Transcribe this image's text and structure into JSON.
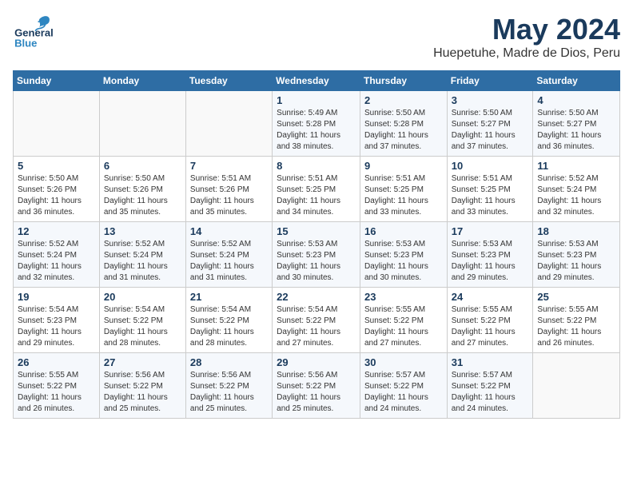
{
  "header": {
    "logo": {
      "general": "General",
      "blue": "Blue"
    },
    "title": "May 2024",
    "subtitle": "Huepetuhe, Madre de Dios, Peru"
  },
  "weekdays": [
    "Sunday",
    "Monday",
    "Tuesday",
    "Wednesday",
    "Thursday",
    "Friday",
    "Saturday"
  ],
  "weeks": [
    [
      {
        "day": "",
        "info": ""
      },
      {
        "day": "",
        "info": ""
      },
      {
        "day": "",
        "info": ""
      },
      {
        "day": "1",
        "info": "Sunrise: 5:49 AM\nSunset: 5:28 PM\nDaylight: 11 hours\nand 38 minutes."
      },
      {
        "day": "2",
        "info": "Sunrise: 5:50 AM\nSunset: 5:28 PM\nDaylight: 11 hours\nand 37 minutes."
      },
      {
        "day": "3",
        "info": "Sunrise: 5:50 AM\nSunset: 5:27 PM\nDaylight: 11 hours\nand 37 minutes."
      },
      {
        "day": "4",
        "info": "Sunrise: 5:50 AM\nSunset: 5:27 PM\nDaylight: 11 hours\nand 36 minutes."
      }
    ],
    [
      {
        "day": "5",
        "info": "Sunrise: 5:50 AM\nSunset: 5:26 PM\nDaylight: 11 hours\nand 36 minutes."
      },
      {
        "day": "6",
        "info": "Sunrise: 5:50 AM\nSunset: 5:26 PM\nDaylight: 11 hours\nand 35 minutes."
      },
      {
        "day": "7",
        "info": "Sunrise: 5:51 AM\nSunset: 5:26 PM\nDaylight: 11 hours\nand 35 minutes."
      },
      {
        "day": "8",
        "info": "Sunrise: 5:51 AM\nSunset: 5:25 PM\nDaylight: 11 hours\nand 34 minutes."
      },
      {
        "day": "9",
        "info": "Sunrise: 5:51 AM\nSunset: 5:25 PM\nDaylight: 11 hours\nand 33 minutes."
      },
      {
        "day": "10",
        "info": "Sunrise: 5:51 AM\nSunset: 5:25 PM\nDaylight: 11 hours\nand 33 minutes."
      },
      {
        "day": "11",
        "info": "Sunrise: 5:52 AM\nSunset: 5:24 PM\nDaylight: 11 hours\nand 32 minutes."
      }
    ],
    [
      {
        "day": "12",
        "info": "Sunrise: 5:52 AM\nSunset: 5:24 PM\nDaylight: 11 hours\nand 32 minutes."
      },
      {
        "day": "13",
        "info": "Sunrise: 5:52 AM\nSunset: 5:24 PM\nDaylight: 11 hours\nand 31 minutes."
      },
      {
        "day": "14",
        "info": "Sunrise: 5:52 AM\nSunset: 5:24 PM\nDaylight: 11 hours\nand 31 minutes."
      },
      {
        "day": "15",
        "info": "Sunrise: 5:53 AM\nSunset: 5:23 PM\nDaylight: 11 hours\nand 30 minutes."
      },
      {
        "day": "16",
        "info": "Sunrise: 5:53 AM\nSunset: 5:23 PM\nDaylight: 11 hours\nand 30 minutes."
      },
      {
        "day": "17",
        "info": "Sunrise: 5:53 AM\nSunset: 5:23 PM\nDaylight: 11 hours\nand 29 minutes."
      },
      {
        "day": "18",
        "info": "Sunrise: 5:53 AM\nSunset: 5:23 PM\nDaylight: 11 hours\nand 29 minutes."
      }
    ],
    [
      {
        "day": "19",
        "info": "Sunrise: 5:54 AM\nSunset: 5:23 PM\nDaylight: 11 hours\nand 29 minutes."
      },
      {
        "day": "20",
        "info": "Sunrise: 5:54 AM\nSunset: 5:22 PM\nDaylight: 11 hours\nand 28 minutes."
      },
      {
        "day": "21",
        "info": "Sunrise: 5:54 AM\nSunset: 5:22 PM\nDaylight: 11 hours\nand 28 minutes."
      },
      {
        "day": "22",
        "info": "Sunrise: 5:54 AM\nSunset: 5:22 PM\nDaylight: 11 hours\nand 27 minutes."
      },
      {
        "day": "23",
        "info": "Sunrise: 5:55 AM\nSunset: 5:22 PM\nDaylight: 11 hours\nand 27 minutes."
      },
      {
        "day": "24",
        "info": "Sunrise: 5:55 AM\nSunset: 5:22 PM\nDaylight: 11 hours\nand 27 minutes."
      },
      {
        "day": "25",
        "info": "Sunrise: 5:55 AM\nSunset: 5:22 PM\nDaylight: 11 hours\nand 26 minutes."
      }
    ],
    [
      {
        "day": "26",
        "info": "Sunrise: 5:55 AM\nSunset: 5:22 PM\nDaylight: 11 hours\nand 26 minutes."
      },
      {
        "day": "27",
        "info": "Sunrise: 5:56 AM\nSunset: 5:22 PM\nDaylight: 11 hours\nand 25 minutes."
      },
      {
        "day": "28",
        "info": "Sunrise: 5:56 AM\nSunset: 5:22 PM\nDaylight: 11 hours\nand 25 minutes."
      },
      {
        "day": "29",
        "info": "Sunrise: 5:56 AM\nSunset: 5:22 PM\nDaylight: 11 hours\nand 25 minutes."
      },
      {
        "day": "30",
        "info": "Sunrise: 5:57 AM\nSunset: 5:22 PM\nDaylight: 11 hours\nand 24 minutes."
      },
      {
        "day": "31",
        "info": "Sunrise: 5:57 AM\nSunset: 5:22 PM\nDaylight: 11 hours\nand 24 minutes."
      },
      {
        "day": "",
        "info": ""
      }
    ]
  ]
}
